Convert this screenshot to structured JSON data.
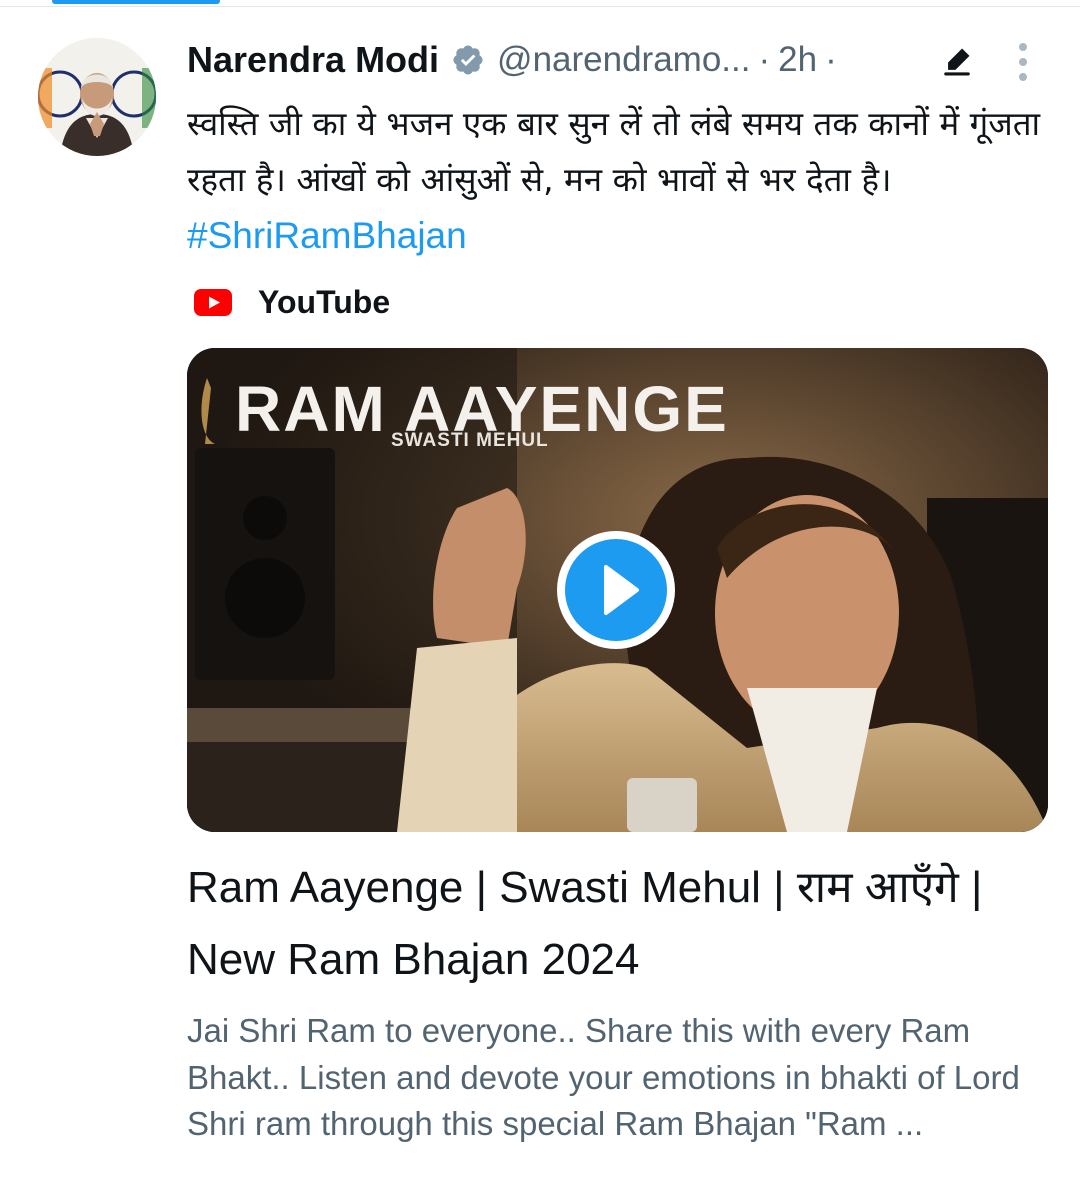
{
  "tweet": {
    "author_name": "Narendra Modi",
    "handle": "@narendramo...",
    "separator": "·",
    "time": "2h",
    "text_hindi": "स्वस्ति जी का ये भजन एक बार सुन लें तो लंबे समय तक कानों में गूंजता रहता है। आंखों को आंसुओं से, मन को भावों से भर देता है।",
    "hashtag": "#ShriRamBhajan",
    "icons": {
      "verified": "verified-badge-icon",
      "edit": "edited-pencil-icon",
      "more": "more-options-icon"
    }
  },
  "card": {
    "source": "YouTube",
    "thumbnail_title": "RAM AAYENGE",
    "thumbnail_subtitle": "SWASTI MEHUL",
    "title": "Ram Aayenge | Swasti Mehul | राम आएँगे | New Ram Bhajan 2024",
    "description": "Jai Shri Ram to everyone.. Share this with every Ram Bhakt.. Listen and devote your emotions in bhakti of Lord Shri ram through this special Ram Bhajan \"Ram ..."
  },
  "colors": {
    "accent": "#1d9bf0",
    "text": "#0f1419",
    "secondary": "#536471",
    "youtube_red": "#ff0000"
  }
}
